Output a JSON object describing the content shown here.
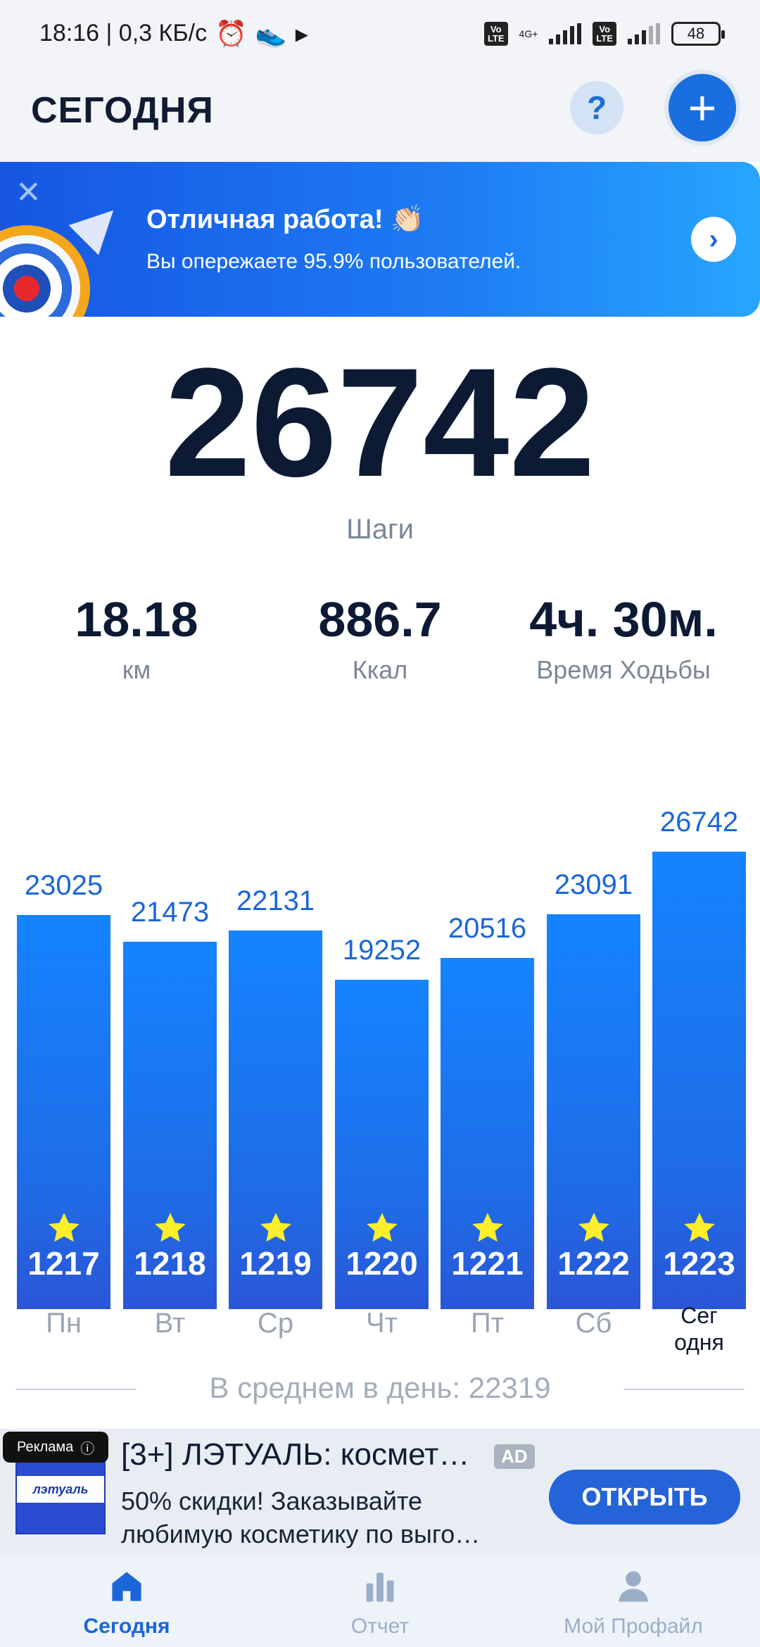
{
  "status_bar": {
    "time_speed": "18:16 | 0,3 КБ/с",
    "network_label": "4G+",
    "volte_label": "Vo LTE",
    "battery": "48"
  },
  "header": {
    "title": "СЕГОДНЯ",
    "help_label": "?",
    "add_label": "+"
  },
  "banner": {
    "title": "Отличная работа! 👏🏻",
    "subtitle": "Вы опережаете 95.9% пользователей."
  },
  "summary": {
    "steps_value": "26742",
    "steps_label": "Шаги",
    "distance_value": "18.18",
    "distance_label": "км",
    "calories_value": "886.7",
    "calories_label": "Ккал",
    "time_value": "4ч. 30м.",
    "time_label": "Время Ходьбы"
  },
  "chart_data": {
    "type": "bar",
    "categories": [
      "Пн",
      "Вт",
      "Ср",
      "Чт",
      "Пт",
      "Сб",
      "Сег одня"
    ],
    "values": [
      23025,
      21473,
      22131,
      19252,
      20516,
      23091,
      26742
    ],
    "bar_numbers": [
      "1217",
      "1218",
      "1219",
      "1220",
      "1221",
      "1222",
      "1223"
    ],
    "title": "",
    "xlabel": "",
    "ylabel": "",
    "grid": false,
    "colors": {
      "bar_top": "#1584ff",
      "bar_bottom": "#2a56d6",
      "value_label": "#1a66d8",
      "star": "#ffef2a"
    }
  },
  "chart_labels": {
    "day1": "Пн",
    "day2": "Вт",
    "day3": "Ср",
    "day4": "Чт",
    "day5": "Пт",
    "day6": "Сб",
    "today_line1": "Сег",
    "today_line2": "одня",
    "val1": "23025",
    "val2": "21473",
    "val3": "22131",
    "val4": "19252",
    "val5": "20516",
    "val6": "23091",
    "val7": "26742",
    "num1": "1217",
    "num2": "1218",
    "num3": "1219",
    "num4": "1220",
    "num5": "1221",
    "num6": "1222",
    "num7": "1223"
  },
  "average": {
    "text": "В среднем в день: 22319"
  },
  "ad": {
    "badge": "Реклама",
    "logo_text": "лэтуаль",
    "title": "[3+] ЛЭТУАЛЬ: космет…",
    "tag": "AD",
    "text": "50% скидки! Заказывайте любимую косметику по выго…",
    "button": "ОТКРЫТЬ"
  },
  "bottom_nav": {
    "today": "Сегодня",
    "report": "Отчет",
    "profile": "Мой Профайл"
  }
}
